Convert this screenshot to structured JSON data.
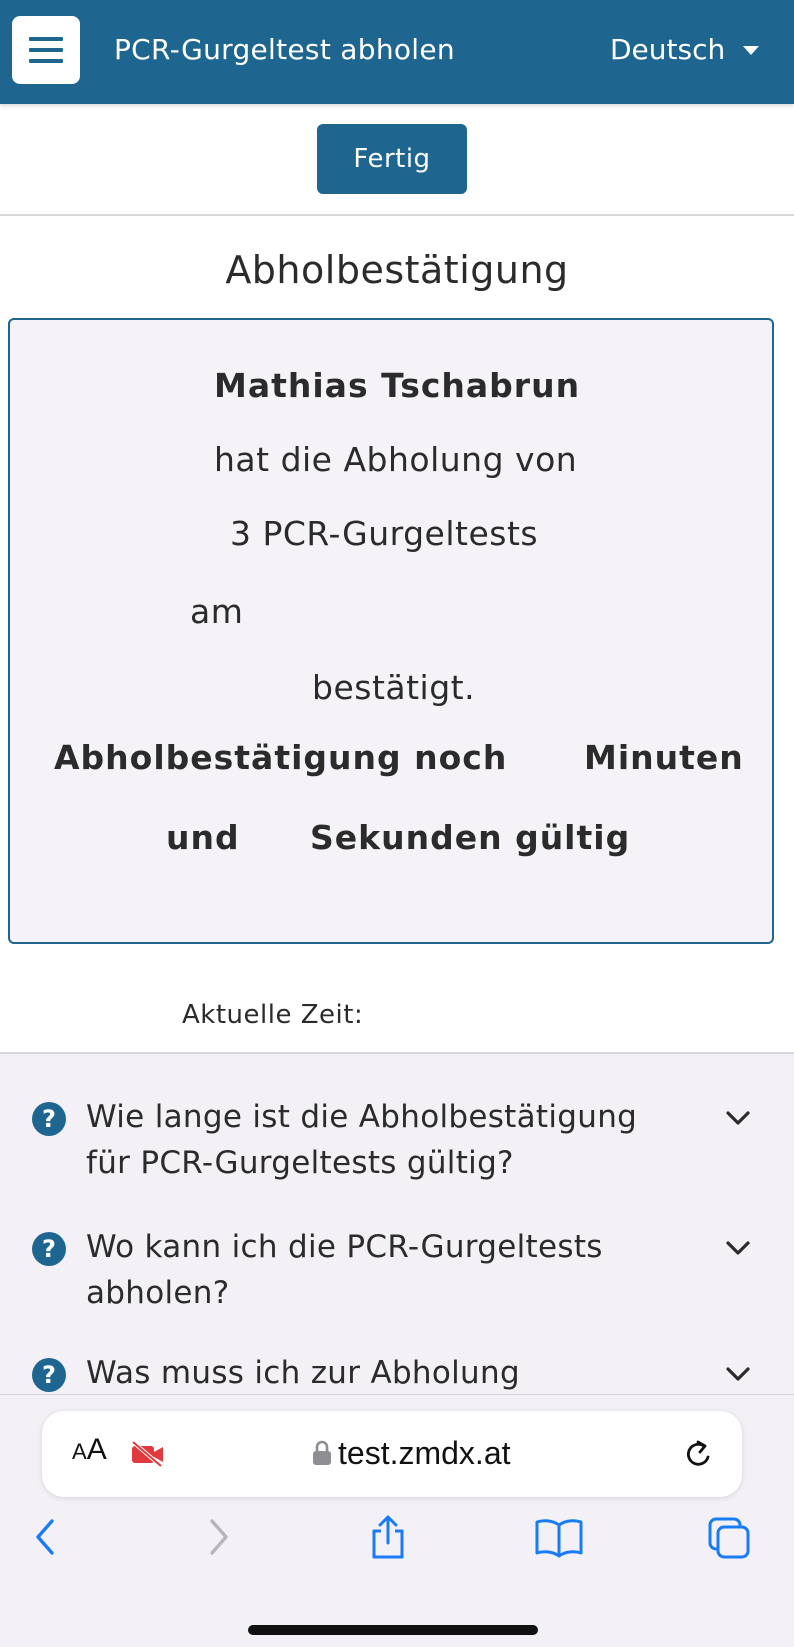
{
  "navbar": {
    "menu_icon": "hamburger-menu-icon",
    "title": "PCR-Gurgeltest abholen",
    "language": "Deutsch"
  },
  "toolbar": {
    "done_label": "Fertig"
  },
  "page_title": "Abholbestätigung",
  "confirmation": {
    "name": "Mathias Tschabrun",
    "line_pickup": "hat die Abholung von",
    "line_tests": "3 PCR-Gurgeltests",
    "line_am": "am",
    "line_confirmed": "bestätigt.",
    "validity_prefix": "Abholbestätigung noch",
    "validity_minutes": "Minuten",
    "validity_and": "und",
    "validity_seconds": "Sekunden gültig"
  },
  "current_time_label": "Aktuelle Zeit:",
  "faq": [
    {
      "question": "Wie lange ist die Abholbestätigung für PCR-Gurgeltests gültig?",
      "icon": "question-circle-icon"
    },
    {
      "question": "Wo kann ich die PCR-Gurgeltests abholen?",
      "icon": "question-circle-icon"
    },
    {
      "question": "Was muss ich zur Abholung",
      "icon": "question-circle-icon"
    }
  ],
  "browser": {
    "text_size_small": "A",
    "text_size_big": "A",
    "url": "test.zmdx.at",
    "icons": [
      "camera-off-icon",
      "lock-icon",
      "reload-icon",
      "back-icon",
      "forward-icon",
      "share-icon",
      "bookmarks-icon",
      "tabs-icon"
    ]
  },
  "colors": {
    "primary": "#1e6690",
    "card_bg": "#f5f3f7",
    "text": "#2b2b2b",
    "camera_off": "#e0393e",
    "ios_blue": "#1a7cf5"
  }
}
